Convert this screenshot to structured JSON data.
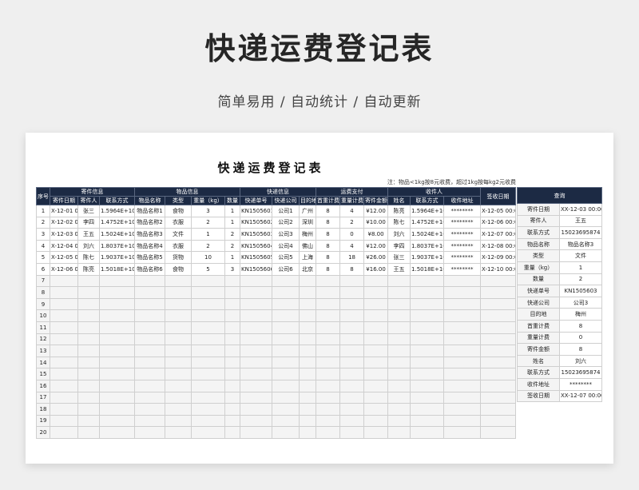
{
  "banner": {
    "title": "快递运费登记表",
    "subtitle": "简单易用 / 自动统计 / 自动更新"
  },
  "sheet": {
    "title": "快递运费登记表",
    "note": "注：物品<1kg按8元收费，超过1kg按每kg2元收费"
  },
  "table": {
    "groups": {
      "seq": "序号",
      "sender": "寄件信息",
      "item": "物品信息",
      "express": "快递信息",
      "fee": "运费支付",
      "receiver": "收件人",
      "sign": "签收日期"
    },
    "columns": [
      "寄件日期",
      "寄件人",
      "联系方式",
      "物品名称",
      "类型",
      "重量（kg）",
      "数量",
      "快递单号",
      "快递公司",
      "目的地",
      "首重计费",
      "重量计费",
      "寄件金额",
      "姓名",
      "联系方式",
      "收件地址"
    ],
    "rows": [
      {
        "no": "1",
        "cells": [
          "X-12-01 00:0",
          "张三",
          "1.5964E+10",
          "物品名称1",
          "食物",
          "3",
          "1",
          "KN1505601",
          "公司1",
          "广州",
          "8",
          "4",
          "¥12.00",
          "陈亮",
          "1.5964E+10",
          "********",
          "X-12-05 00:0"
        ]
      },
      {
        "no": "2",
        "cells": [
          "X-12-02 00:0",
          "李四",
          "1.4752E+10",
          "物品名称2",
          "衣服",
          "2",
          "1",
          "KN1505602",
          "公司2",
          "深圳",
          "8",
          "2",
          "¥10.00",
          "陈七",
          "1.4752E+10",
          "********",
          "X-12-06 00:0"
        ]
      },
      {
        "no": "3",
        "cells": [
          "X-12-03 00:0",
          "王五",
          "1.5024E+10",
          "物品名称3",
          "文件",
          "1",
          "2",
          "KN1505603",
          "公司3",
          "梅州",
          "8",
          "0",
          "¥8.00",
          "刘六",
          "1.5024E+10",
          "********",
          "X-12-07 00:0"
        ]
      },
      {
        "no": "4",
        "cells": [
          "X-12-04 00:0",
          "刘六",
          "1.8037E+10",
          "物品名称4",
          "衣服",
          "2",
          "2",
          "KN1505604",
          "公司4",
          "佛山",
          "8",
          "4",
          "¥12.00",
          "李四",
          "1.8037E+10",
          "********",
          "X-12-08 00:0"
        ]
      },
      {
        "no": "5",
        "cells": [
          "X-12-05 00:0",
          "陈七",
          "1.9037E+10",
          "物品名称5",
          "货物",
          "10",
          "1",
          "KN1505605",
          "公司5",
          "上海",
          "8",
          "18",
          "¥26.00",
          "张三",
          "1.9037E+10",
          "********",
          "X-12-09 00:0"
        ]
      },
      {
        "no": "6",
        "cells": [
          "X-12-06 00:0",
          "陈亮",
          "1.5018E+10",
          "物品名称6",
          "食物",
          "5",
          "3",
          "KN1505606",
          "公司6",
          "北京",
          "8",
          "8",
          "¥16.00",
          "王五",
          "1.5018E+10",
          "********",
          "X-12-10 00:0"
        ]
      },
      {
        "no": "7",
        "cells": []
      },
      {
        "no": "8",
        "cells": []
      },
      {
        "no": "9",
        "cells": []
      },
      {
        "no": "10",
        "cells": []
      },
      {
        "no": "11",
        "cells": []
      },
      {
        "no": "12",
        "cells": []
      },
      {
        "no": "13",
        "cells": []
      },
      {
        "no": "14",
        "cells": []
      },
      {
        "no": "15",
        "cells": []
      },
      {
        "no": "16",
        "cells": []
      },
      {
        "no": "17",
        "cells": []
      },
      {
        "no": "18",
        "cells": []
      },
      {
        "no": "19",
        "cells": []
      },
      {
        "no": "20",
        "cells": []
      }
    ]
  },
  "query": {
    "header": "查询",
    "rows": [
      {
        "label": "寄件日期",
        "value": "XX-12-03 00:00:00"
      },
      {
        "label": "寄件人",
        "value": "王五"
      },
      {
        "label": "联系方式",
        "value": "15023695874"
      },
      {
        "label": "物品名称",
        "value": "物品名称3"
      },
      {
        "label": "类型",
        "value": "文件"
      },
      {
        "label": "重量（kg）",
        "value": "1"
      },
      {
        "label": "数量",
        "value": "2"
      },
      {
        "label": "快递单号",
        "value": "KN1505603"
      },
      {
        "label": "快递公司",
        "value": "公司3"
      },
      {
        "label": "目的地",
        "value": "梅州"
      },
      {
        "label": "首重计费",
        "value": "8"
      },
      {
        "label": "重量计费",
        "value": "0"
      },
      {
        "label": "寄件金额",
        "value": "8"
      },
      {
        "label": "姓名",
        "value": "刘六"
      },
      {
        "label": "联系方式",
        "value": "15023695874"
      },
      {
        "label": "收件地址",
        "value": "********"
      },
      {
        "label": "签收日期",
        "value": "XX-12-07 00:00:00"
      }
    ]
  }
}
